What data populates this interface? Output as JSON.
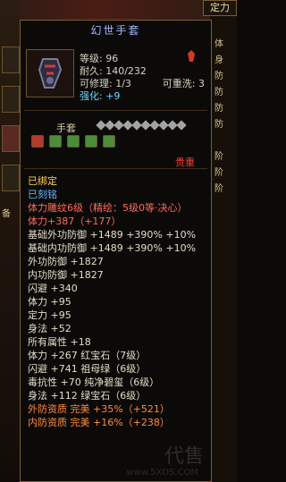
{
  "app": {
    "top_right_button": "定力",
    "right_labels": [
      "体",
      "身",
      "防",
      "防",
      "防",
      "防",
      "阶",
      "阶",
      "阶"
    ],
    "left_text": "备"
  },
  "tooltip": {
    "title": "幻世手套",
    "level": "等级: 96",
    "durability": "耐久: 140/232",
    "repairable": "可修理: 1/3",
    "reforge": "可重洗: 3",
    "enhance": "强化: +9",
    "section_title": "手套",
    "rarity": "贵重",
    "stars": 10,
    "gems": [
      "red",
      "green",
      "green",
      "green",
      "green"
    ]
  },
  "attributes": [
    {
      "text": "已绑定",
      "class": "yellow"
    },
    {
      "text": "已刻铭",
      "class": "blue"
    },
    {
      "text": "体力雕纹6级（精绘：5级0等·决心）",
      "class": "red"
    },
    {
      "text": "体力+387（+177）",
      "class": "red"
    },
    {
      "text": "基础外功防御 +1489 +390% +10%",
      "class": ""
    },
    {
      "text": "基础内功防御 +1489 +390% +10%",
      "class": ""
    },
    {
      "text": "外功防御 +1827",
      "class": ""
    },
    {
      "text": "内功防御 +1827",
      "class": ""
    },
    {
      "text": "闪避 +340",
      "class": ""
    },
    {
      "text": "体力 +95",
      "class": ""
    },
    {
      "text": "定力 +95",
      "class": ""
    },
    {
      "text": "身法 +52",
      "class": ""
    },
    {
      "text": "所有属性 +18",
      "class": ""
    },
    {
      "text": "体力 +267  红宝石（7级）",
      "class": ""
    },
    {
      "text": "闪避 +741  祖母绿（6级）",
      "class": ""
    },
    {
      "text": "毒抗性 +70  纯净碧玺（6级）",
      "class": ""
    },
    {
      "text": "身法 +112  绿宝石（6级）",
      "class": ""
    },
    {
      "text": "外防资质  完美 +35%（+521）",
      "class": "orange"
    },
    {
      "text": "内防资质  完美 +16%（+238）",
      "class": "orange"
    }
  ],
  "watermark": {
    "title": "代售",
    "url": "www.5XDS.COM"
  }
}
